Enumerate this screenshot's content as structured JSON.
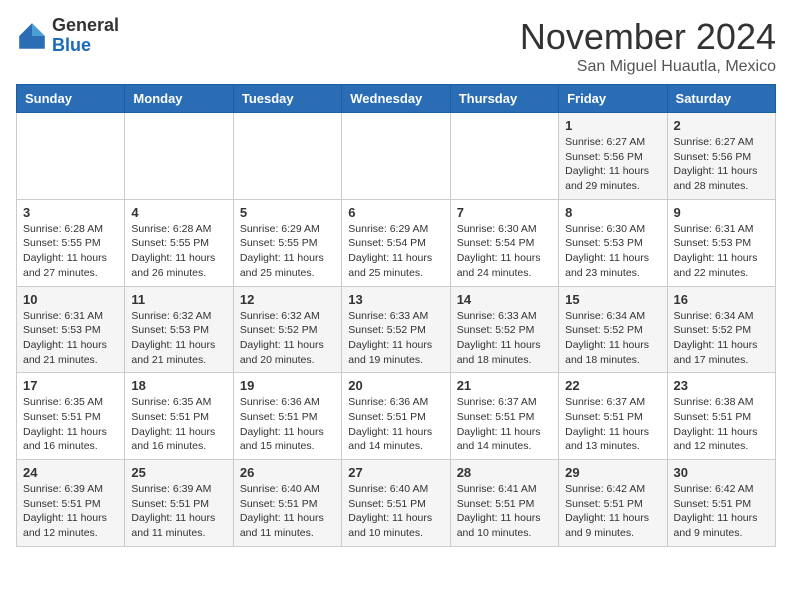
{
  "logo": {
    "general": "General",
    "blue": "Blue"
  },
  "header": {
    "month": "November 2024",
    "location": "San Miguel Huautla, Mexico"
  },
  "weekdays": [
    "Sunday",
    "Monday",
    "Tuesday",
    "Wednesday",
    "Thursday",
    "Friday",
    "Saturday"
  ],
  "weeks": [
    [
      {
        "day": "",
        "info": ""
      },
      {
        "day": "",
        "info": ""
      },
      {
        "day": "",
        "info": ""
      },
      {
        "day": "",
        "info": ""
      },
      {
        "day": "",
        "info": ""
      },
      {
        "day": "1",
        "info": "Sunrise: 6:27 AM\nSunset: 5:56 PM\nDaylight: 11 hours and 29 minutes."
      },
      {
        "day": "2",
        "info": "Sunrise: 6:27 AM\nSunset: 5:56 PM\nDaylight: 11 hours and 28 minutes."
      }
    ],
    [
      {
        "day": "3",
        "info": "Sunrise: 6:28 AM\nSunset: 5:55 PM\nDaylight: 11 hours and 27 minutes."
      },
      {
        "day": "4",
        "info": "Sunrise: 6:28 AM\nSunset: 5:55 PM\nDaylight: 11 hours and 26 minutes."
      },
      {
        "day": "5",
        "info": "Sunrise: 6:29 AM\nSunset: 5:55 PM\nDaylight: 11 hours and 25 minutes."
      },
      {
        "day": "6",
        "info": "Sunrise: 6:29 AM\nSunset: 5:54 PM\nDaylight: 11 hours and 25 minutes."
      },
      {
        "day": "7",
        "info": "Sunrise: 6:30 AM\nSunset: 5:54 PM\nDaylight: 11 hours and 24 minutes."
      },
      {
        "day": "8",
        "info": "Sunrise: 6:30 AM\nSunset: 5:53 PM\nDaylight: 11 hours and 23 minutes."
      },
      {
        "day": "9",
        "info": "Sunrise: 6:31 AM\nSunset: 5:53 PM\nDaylight: 11 hours and 22 minutes."
      }
    ],
    [
      {
        "day": "10",
        "info": "Sunrise: 6:31 AM\nSunset: 5:53 PM\nDaylight: 11 hours and 21 minutes."
      },
      {
        "day": "11",
        "info": "Sunrise: 6:32 AM\nSunset: 5:53 PM\nDaylight: 11 hours and 21 minutes."
      },
      {
        "day": "12",
        "info": "Sunrise: 6:32 AM\nSunset: 5:52 PM\nDaylight: 11 hours and 20 minutes."
      },
      {
        "day": "13",
        "info": "Sunrise: 6:33 AM\nSunset: 5:52 PM\nDaylight: 11 hours and 19 minutes."
      },
      {
        "day": "14",
        "info": "Sunrise: 6:33 AM\nSunset: 5:52 PM\nDaylight: 11 hours and 18 minutes."
      },
      {
        "day": "15",
        "info": "Sunrise: 6:34 AM\nSunset: 5:52 PM\nDaylight: 11 hours and 18 minutes."
      },
      {
        "day": "16",
        "info": "Sunrise: 6:34 AM\nSunset: 5:52 PM\nDaylight: 11 hours and 17 minutes."
      }
    ],
    [
      {
        "day": "17",
        "info": "Sunrise: 6:35 AM\nSunset: 5:51 PM\nDaylight: 11 hours and 16 minutes."
      },
      {
        "day": "18",
        "info": "Sunrise: 6:35 AM\nSunset: 5:51 PM\nDaylight: 11 hours and 16 minutes."
      },
      {
        "day": "19",
        "info": "Sunrise: 6:36 AM\nSunset: 5:51 PM\nDaylight: 11 hours and 15 minutes."
      },
      {
        "day": "20",
        "info": "Sunrise: 6:36 AM\nSunset: 5:51 PM\nDaylight: 11 hours and 14 minutes."
      },
      {
        "day": "21",
        "info": "Sunrise: 6:37 AM\nSunset: 5:51 PM\nDaylight: 11 hours and 14 minutes."
      },
      {
        "day": "22",
        "info": "Sunrise: 6:37 AM\nSunset: 5:51 PM\nDaylight: 11 hours and 13 minutes."
      },
      {
        "day": "23",
        "info": "Sunrise: 6:38 AM\nSunset: 5:51 PM\nDaylight: 11 hours and 12 minutes."
      }
    ],
    [
      {
        "day": "24",
        "info": "Sunrise: 6:39 AM\nSunset: 5:51 PM\nDaylight: 11 hours and 12 minutes."
      },
      {
        "day": "25",
        "info": "Sunrise: 6:39 AM\nSunset: 5:51 PM\nDaylight: 11 hours and 11 minutes."
      },
      {
        "day": "26",
        "info": "Sunrise: 6:40 AM\nSunset: 5:51 PM\nDaylight: 11 hours and 11 minutes."
      },
      {
        "day": "27",
        "info": "Sunrise: 6:40 AM\nSunset: 5:51 PM\nDaylight: 11 hours and 10 minutes."
      },
      {
        "day": "28",
        "info": "Sunrise: 6:41 AM\nSunset: 5:51 PM\nDaylight: 11 hours and 10 minutes."
      },
      {
        "day": "29",
        "info": "Sunrise: 6:42 AM\nSunset: 5:51 PM\nDaylight: 11 hours and 9 minutes."
      },
      {
        "day": "30",
        "info": "Sunrise: 6:42 AM\nSunset: 5:51 PM\nDaylight: 11 hours and 9 minutes."
      }
    ]
  ]
}
